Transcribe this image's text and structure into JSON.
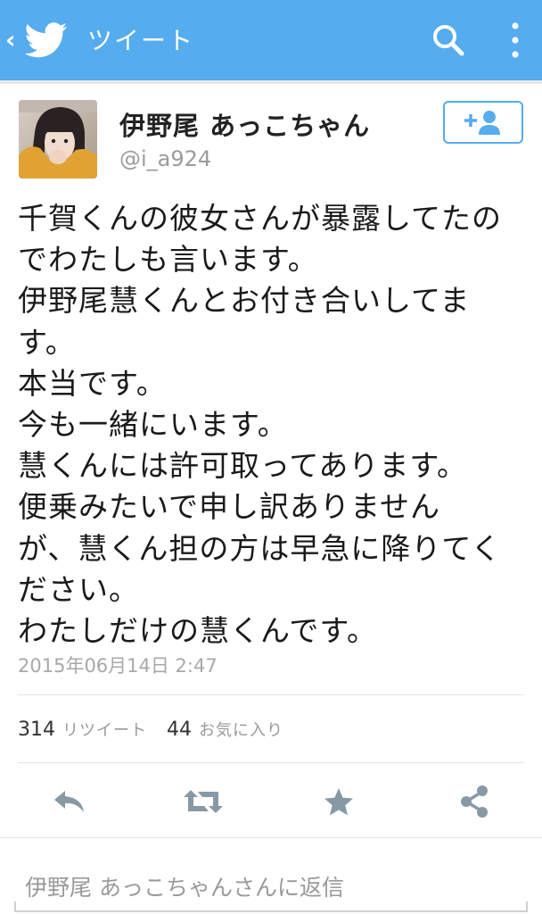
{
  "header": {
    "back_icon": "chevron-left-icon",
    "logo_icon": "twitter-bird-icon",
    "title": "ツイート",
    "search_icon": "search-icon",
    "more_icon": "more-vertical-icon",
    "bar_color": "#55acee"
  },
  "tweet": {
    "author": {
      "display_name": "伊野尾 あっこちゃん",
      "handle": "@i_a924"
    },
    "follow_icon": "add-user-icon",
    "lines": [
      "千賀くんの彼女さんが暴露してたの",
      "でわたしも言います。",
      "伊野尾慧くんとお付き合いしてま",
      "す。",
      "本当です。",
      "今も一緒にいます。",
      "慧くんには許可取ってあります。",
      "便乗みたいで申し訳ありません",
      "が、慧くん担の方は早急に降りてく",
      "ださい。",
      "わたしだけの慧くんです。"
    ],
    "timestamp": "2015年06月14日 2:47",
    "stats": {
      "retweets": "314",
      "retweets_label": "リツイート",
      "favorites": "44",
      "favorites_label": "お気に入り"
    },
    "actions": {
      "reply_icon": "reply-icon",
      "retweet_icon": "retweet-icon",
      "favorite_icon": "star-icon",
      "share_icon": "share-icon"
    }
  },
  "reply": {
    "placeholder": "伊野尾 あっこちゃんさんに返信"
  },
  "colors": {
    "accent": "#55acee",
    "icon_gray": "#8899a6",
    "meta_gray": "#a8a8a8"
  }
}
